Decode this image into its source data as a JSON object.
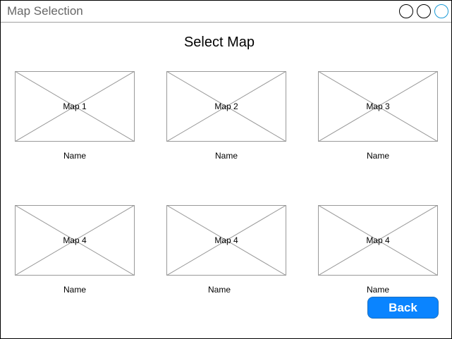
{
  "window": {
    "title": "Map Selection",
    "controls": [
      "circle-icon",
      "circle-icon",
      "circle-icon"
    ]
  },
  "heading": "Select Map",
  "maps": [
    {
      "thumb_label": "Map 1",
      "name": "Name"
    },
    {
      "thumb_label": "Map 2",
      "name": "Name"
    },
    {
      "thumb_label": "Map 3",
      "name": "Name"
    },
    {
      "thumb_label": "Map 4",
      "name": "Name"
    },
    {
      "thumb_label": "Map 4",
      "name": "Name"
    },
    {
      "thumb_label": "Map 4",
      "name": "Name"
    }
  ],
  "back_label": "Back",
  "colors": {
    "button": "#0a84ff",
    "placeholder_stroke": "#999999",
    "title_text": "#666666"
  }
}
